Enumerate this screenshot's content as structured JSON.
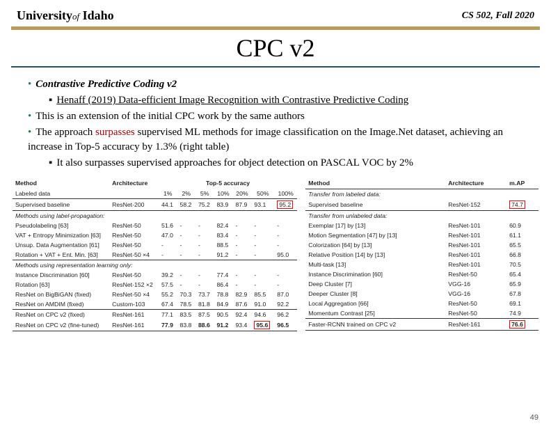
{
  "header": {
    "logo1": "University",
    "logoOf": "of",
    "logo2": "Idaho",
    "course": "CS 502, Fall 2020"
  },
  "title": "CPC v2",
  "bul": {
    "b1": "Contrastive Predictive Coding v2",
    "b1a": "Henaff (2019) Data-efficient Image Recognition with Contrastive Predictive Coding",
    "b2": "This is an extension of the initial CPC work by the same authors",
    "b3a": "The approach ",
    "b3red": "surpasses",
    "b3b": " supervised ML methods for image classification on the Image.Net dataset, achieving an increase in Top-5 accuracy by 1.3% (right table)",
    "b4": "It also surpasses supervised approaches for object detection on PASCAL VOC by 2%"
  },
  "t1": {
    "h": [
      "Method",
      "Architecture",
      "1%",
      "2%",
      "5%",
      "10%",
      "20%",
      "50%",
      "100%"
    ],
    "hgroup": "Top-5 accuracy",
    "rows": [
      [
        "Labeled data",
        "",
        "",
        "",
        "",
        "",
        "",
        "",
        ""
      ],
      [
        "Supervised baseline",
        "ResNet-200",
        "44.1",
        "58.2",
        "75.2",
        "83.9",
        "87.9",
        "93.1",
        "95.2"
      ],
      [
        "Methods using label-propagation:",
        "",
        "",
        "",
        "",
        "",
        "",
        "",
        ""
      ],
      [
        "Pseudolabeling [63]",
        "ResNet-50",
        "51.6",
        "-",
        "-",
        "82.4",
        "-",
        "-",
        "-"
      ],
      [
        "VAT + Entropy Minimization [63]",
        "ResNet-50",
        "47.0",
        "-",
        "-",
        "83.4",
        "-",
        "-",
        "-"
      ],
      [
        "Unsup. Data Augmentation [61]",
        "ResNet-50",
        "-",
        "-",
        "-",
        "88.5",
        "-",
        "-",
        "-"
      ],
      [
        "Rotation + VAT + Ent. Min. [63]",
        "ResNet-50 ×4",
        "-",
        "-",
        "-",
        "91.2",
        "-",
        "-",
        "95.0"
      ],
      [
        "Methods using representation learning only:",
        "",
        "",
        "",
        "",
        "",
        "",
        "",
        ""
      ],
      [
        "Instance Discrimination [60]",
        "ResNet-50",
        "39.2",
        "-",
        "-",
        "77.4",
        "-",
        "-",
        "-"
      ],
      [
        "Rotation [63]",
        "ResNet-152 ×2",
        "57.5",
        "-",
        "-",
        "86.4",
        "-",
        "-",
        "-"
      ],
      [
        "ResNet on BigBiGAN (fixed)",
        "ResNet-50 ×4",
        "55.2",
        "70.3",
        "73.7",
        "78.8",
        "82.9",
        "85.5",
        "87.0"
      ],
      [
        "ResNet on AMDIM (fixed)",
        "Custom-103",
        "67.4",
        "78.5",
        "81.8",
        "84.9",
        "87.6",
        "91.0",
        "92.2"
      ],
      [
        "ResNet on CPC v2 (fixed)",
        "ResNet-161",
        "77.1",
        "83.5",
        "87.5",
        "90.5",
        "92.4",
        "94.6",
        "96.2"
      ],
      [
        "ResNet on CPC v2 (fine-tuned)",
        "ResNet-161",
        "77.9",
        "83.8",
        "88.6",
        "91.2",
        "93.4",
        "95.6",
        "96.5"
      ]
    ]
  },
  "t2": {
    "h": [
      "Method",
      "Architecture",
      "m.AP"
    ],
    "rows": [
      [
        "Transfer from labeled data:",
        "",
        ""
      ],
      [
        "Supervised baseline",
        "ResNet-152",
        "74.7"
      ],
      [
        "Transfer from unlabeled data:",
        "",
        ""
      ],
      [
        "Exemplar [17] by [13]",
        "ResNet-101",
        "60.9"
      ],
      [
        "Motion Segmentation [47] by [13]",
        "ResNet-101",
        "61.1"
      ],
      [
        "Colorization [64] by [13]",
        "ResNet-101",
        "65.5"
      ],
      [
        "Relative Position [14] by [13]",
        "ResNet-101",
        "66.8"
      ],
      [
        "Multi-task [13]",
        "ResNet-101",
        "70.5"
      ],
      [
        "Instance Discrimination [60]",
        "ResNet-50",
        "65.4"
      ],
      [
        "Deep Cluster [7]",
        "VGG-16",
        "65.9"
      ],
      [
        "Deeper Cluster [8]",
        "VGG-16",
        "67.8"
      ],
      [
        "Local Aggregation [66]",
        "ResNet-50",
        "69.1"
      ],
      [
        "Momentum Contrast [25]",
        "ResNet-50",
        "74.9"
      ],
      [
        "Faster-RCNN trained on CPC v2",
        "ResNet-161",
        "76.6"
      ]
    ]
  },
  "page": "49"
}
